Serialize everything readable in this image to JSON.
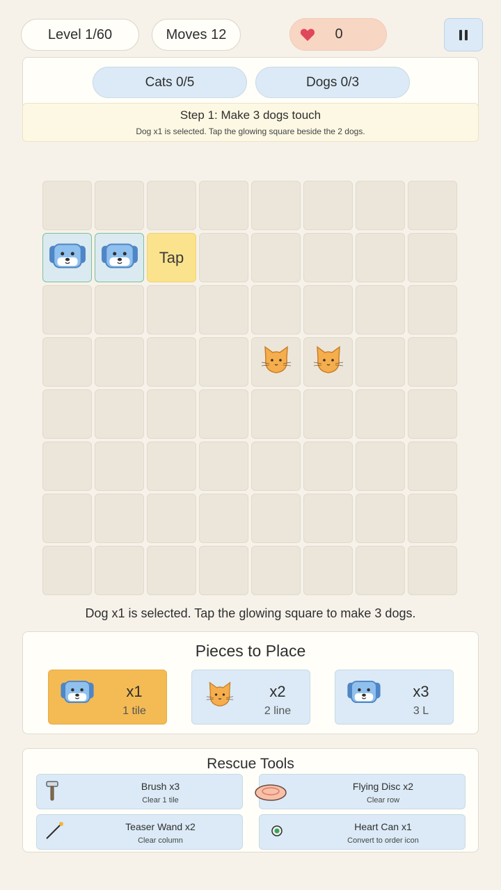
{
  "header": {
    "level": "Level 1/60",
    "moves": "Moves 12",
    "hearts": "0",
    "heart_icon": "heart-icon",
    "pause_icon": "pause-icon"
  },
  "goals": [
    {
      "label": "Cats 0/5"
    },
    {
      "label": "Dogs 0/3"
    }
  ],
  "step": {
    "title": "Step 1: Make 3 dogs touch",
    "subtitle": "Dog x1 is selected. Tap the glowing square beside the 2 dogs."
  },
  "board": {
    "rows": 8,
    "cols": 8,
    "tiles": [
      {
        "row": 1,
        "col": 0,
        "type": "dog"
      },
      {
        "row": 1,
        "col": 1,
        "type": "dog"
      },
      {
        "row": 1,
        "col": 2,
        "type": "tap",
        "label": "Tap"
      },
      {
        "row": 3,
        "col": 4,
        "type": "cat"
      },
      {
        "row": 3,
        "col": 5,
        "type": "cat"
      }
    ]
  },
  "hint": "Dog x1 is selected. Tap the glowing square to make 3 dogs.",
  "pieces": {
    "title": "Pieces to Place",
    "items": [
      {
        "icon": "dog-icon",
        "count": "x1",
        "shape": "1 tile",
        "selected": true
      },
      {
        "icon": "cat-icon",
        "count": "x2",
        "shape": "2 line",
        "selected": false
      },
      {
        "icon": "dog-icon",
        "count": "x3",
        "shape": "3 L",
        "selected": false
      }
    ]
  },
  "tools": {
    "title": "Rescue Tools",
    "items": [
      {
        "icon": "brush-icon",
        "name": "Brush x3",
        "desc": "Clear 1 tile"
      },
      {
        "icon": "flying-disc-icon",
        "name": "Flying Disc x2",
        "desc": "Clear row"
      },
      {
        "icon": "teaser-wand-icon",
        "name": "Teaser Wand x2",
        "desc": "Clear column"
      },
      {
        "icon": "heart-can-icon",
        "name": "Heart Can x1",
        "desc": "Convert to order icon"
      }
    ]
  },
  "colors": {
    "background": "#f6f2ea",
    "selected_piece": "#f4bb54",
    "tap_tile": "#fbe38d",
    "chip_blue": "#dbeaf6",
    "heart": "#e0475b"
  }
}
